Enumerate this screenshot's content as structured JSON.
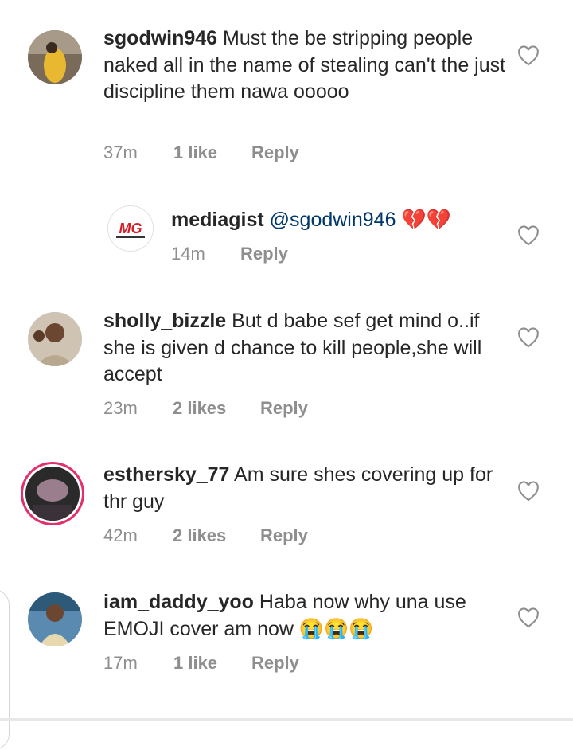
{
  "comments": [
    {
      "username": "sgodwin946",
      "text": "Must the be stripping people naked all in the name of stealing can't the just discipline them nawa ooooo",
      "time": "37m",
      "likes": "1 like",
      "reply": "Reply"
    },
    {
      "username": "mediagist",
      "mention": "@sgodwin946",
      "emoji": "💔💔",
      "time": "14m",
      "reply": "Reply",
      "avatar_logo": "MG"
    },
    {
      "username": "sholly_bizzle",
      "text": "But d babe sef get mind o..if she is given d chance to kill people,she will accept",
      "time": "23m",
      "likes": "2 likes",
      "reply": "Reply"
    },
    {
      "username": "esthersky_77",
      "text": "Am sure shes covering up for thr guy",
      "time": "42m",
      "likes": "2 likes",
      "reply": "Reply"
    },
    {
      "username": "iam_daddy_yoo",
      "text": "Haba now why una use EMOJI cover am now",
      "emoji": "😭😭😭",
      "time": "17m",
      "likes": "1 like",
      "reply": "Reply"
    }
  ],
  "colors": {
    "text": "#262626",
    "meta": "#8e8e8e",
    "mention": "#00376b",
    "story_ring": "#e1306c"
  },
  "icons": [
    "heart-outline-icon"
  ]
}
